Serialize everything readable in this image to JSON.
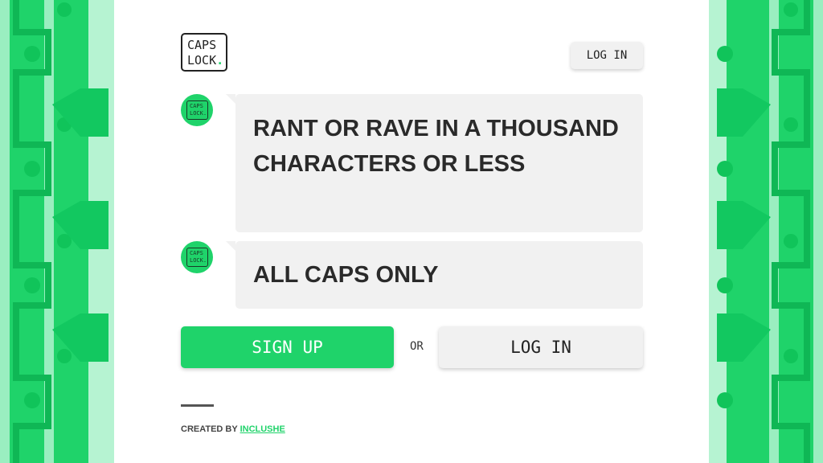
{
  "logo": {
    "line1": "CAPS",
    "line2": "LOCK",
    "dot": "."
  },
  "header": {
    "login_label": "LOG IN"
  },
  "messages": [
    {
      "text": "RANT OR RAVE IN A THOUSAND CHARACTERS OR LESS"
    },
    {
      "text": "ALL CAPS ONLY"
    }
  ],
  "actions": {
    "signup_label": "SIGN UP",
    "or_label": "OR",
    "login_label": "LOG IN"
  },
  "footer": {
    "created_by": "CREATED BY",
    "author": "INCLUSHE"
  },
  "colors": {
    "accent": "#1fd36a",
    "panel_bg": "#f1f1f1"
  },
  "icons": {
    "avatar": "caps-lock-logo-icon"
  }
}
